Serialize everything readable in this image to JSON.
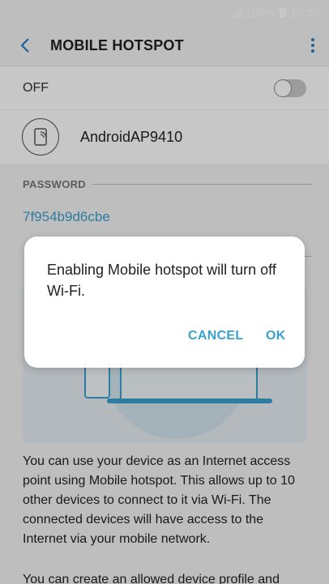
{
  "status_bar": {
    "battery": "100%",
    "time": "10:00"
  },
  "header": {
    "title": "MOBILE HOTSPOT"
  },
  "switch_row": {
    "label": "OFF",
    "state": "off"
  },
  "device": {
    "name": "AndroidAP9410"
  },
  "password": {
    "section_label": "PASSWORD",
    "value": "7f954b9d6cbe"
  },
  "dialog": {
    "message": "Enabling Mobile hotspot will turn off Wi-Fi.",
    "cancel_label": "CANCEL",
    "ok_label": "OK"
  },
  "description": {
    "paragraph1": "You can use your device as an Internet access point using Mobile hotspot. This allows up to 10 other devices to connect to it via Wi-Fi. The connected devices will have access to the Internet via your mobile network.",
    "paragraph2": "You can create an allowed device profile and"
  },
  "colors": {
    "accent": "#3ba0ce",
    "back_arrow": "#2a7bbf",
    "background": "#f4f4f4"
  },
  "icons": [
    "signal-icon",
    "battery-icon",
    "back-arrow-icon",
    "more-options-icon",
    "hotspot-device-icon"
  ]
}
